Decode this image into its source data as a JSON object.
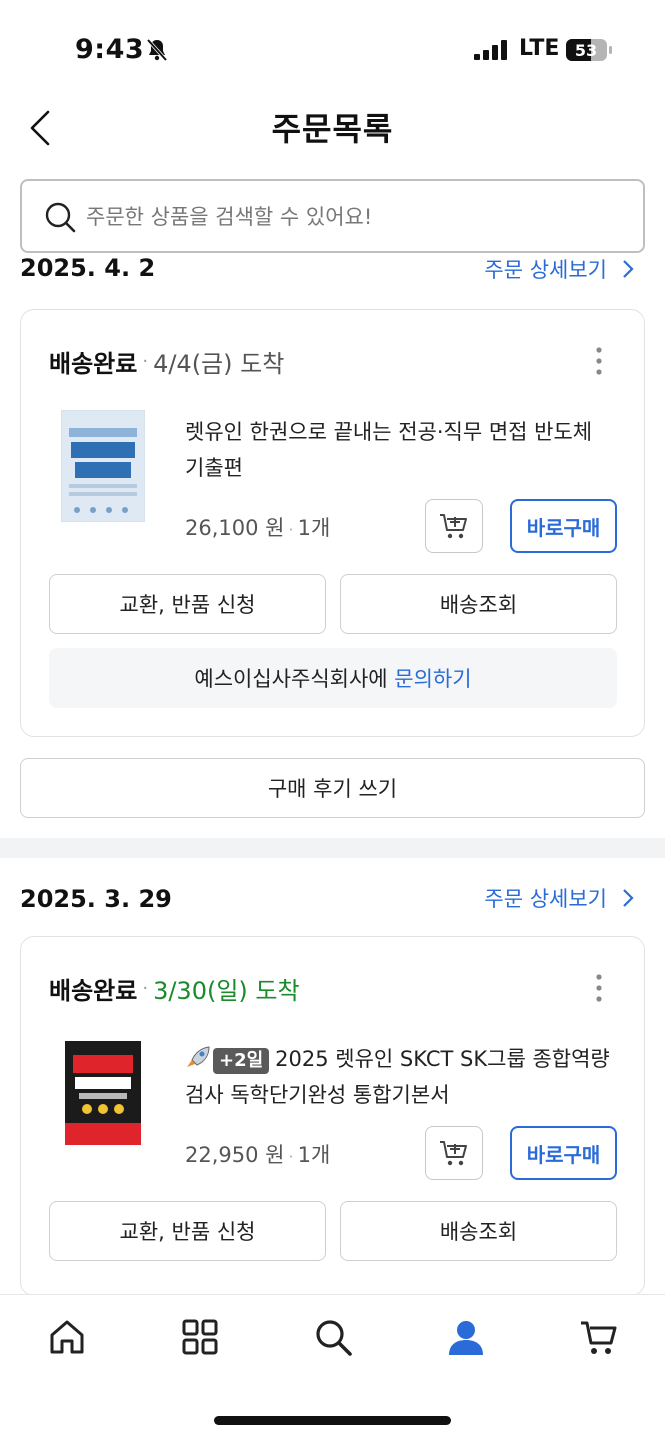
{
  "status_bar": {
    "time": "9:43",
    "network": "LTE",
    "battery": "53"
  },
  "header": {
    "title": "주문목록"
  },
  "search": {
    "placeholder": "주문한 상품을 검색할 수 있어요!"
  },
  "orders": [
    {
      "date": "2025. 4. 2",
      "detail_link": "주문 상세보기",
      "status": "배송완료",
      "arrival": "4/4(금) 도착",
      "product": {
        "name": "렛유인 한권으로 끝내는 전공·직무 면접 반도체 기출편",
        "price": "26,100 원",
        "quantity": "1개"
      },
      "buy_now": "바로구매",
      "exchange_return": "교환, 반품 신청",
      "tracking": "배송조회",
      "inquiry_seller": "예스이십사주식회사에",
      "inquiry_link": "문의하기",
      "review": "구매 후기 쓰기"
    },
    {
      "date": "2025. 3. 29",
      "detail_link": "주문 상세보기",
      "status": "배송완료",
      "arrival": "3/30(일) 도착",
      "product": {
        "badge": "+2일",
        "name": "2025 렛유인 SKCT SK그룹 종합역량검사 독학단기완성 통합기본서",
        "price": "22,950 원",
        "quantity": "1개"
      },
      "buy_now": "바로구매",
      "exchange_return": "교환, 반품 신청",
      "tracking": "배송조회"
    }
  ],
  "tabbar": {
    "items": [
      "home-icon",
      "category-grid-icon",
      "search-icon",
      "my-page-icon",
      "cart-icon"
    ],
    "active_color": "#2a6bd8"
  },
  "colors": {
    "accent": "#2a6bd8",
    "arrival_green": "#1a8a2b"
  }
}
